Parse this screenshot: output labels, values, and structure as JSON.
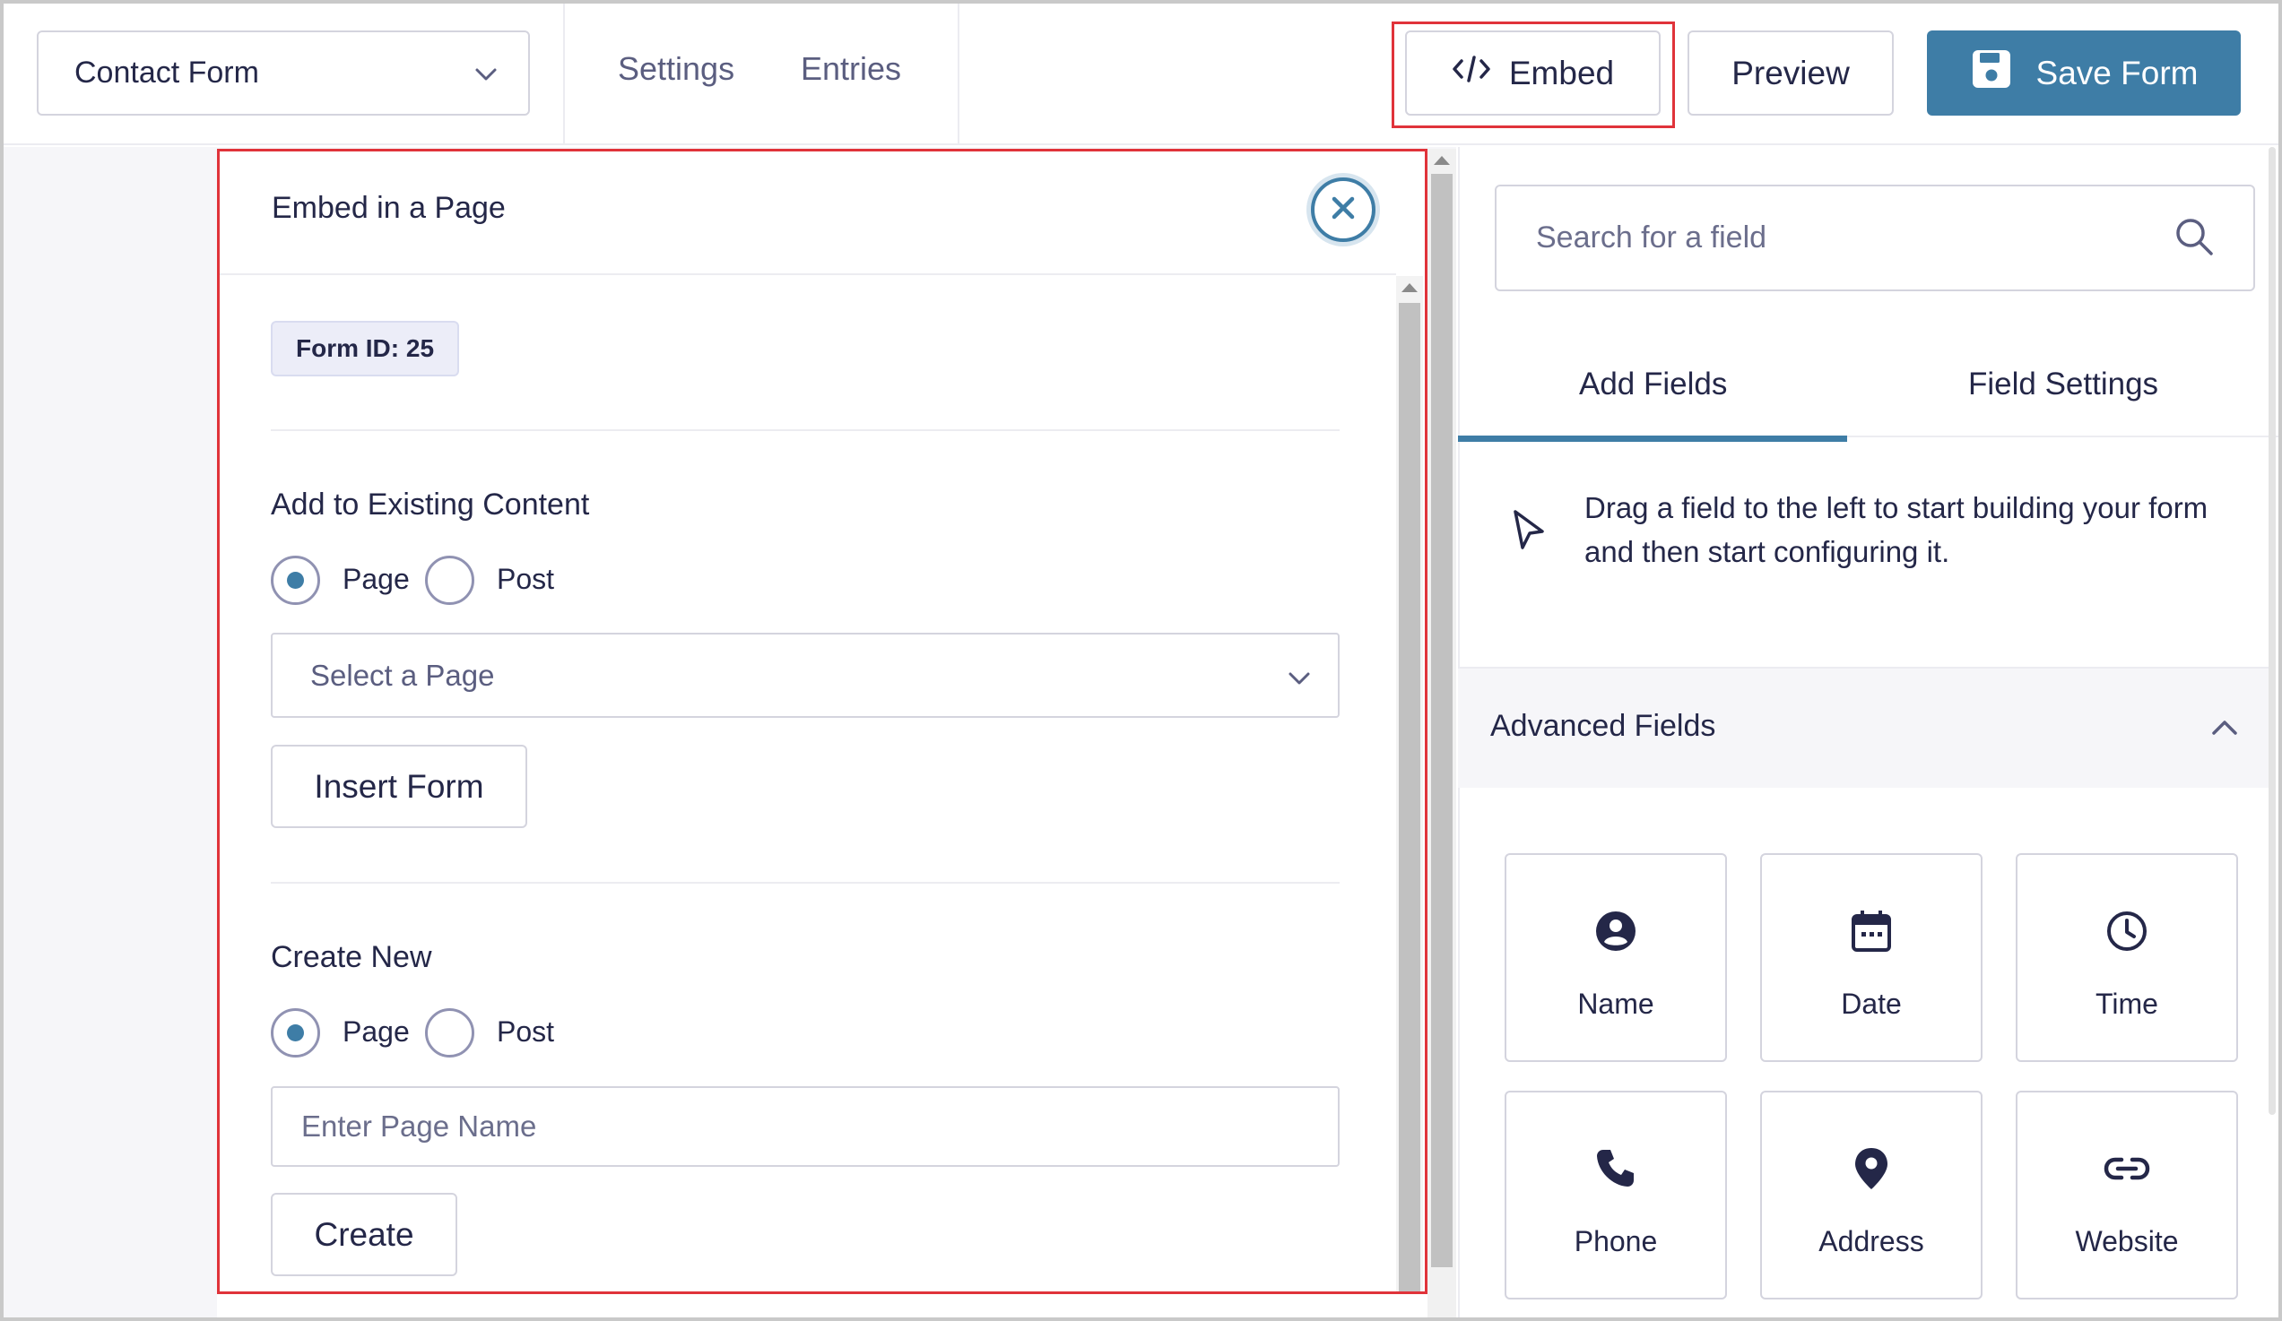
{
  "topbar": {
    "form_selector": "Contact Form",
    "nav": [
      "Settings",
      "Entries"
    ],
    "embed_label": "Embed",
    "preview_label": "Preview",
    "save_label": "Save Form"
  },
  "embed_panel": {
    "title": "Embed in a Page",
    "form_id": "Form ID: 25",
    "existing": {
      "heading": "Add to Existing Content",
      "radio_page": "Page",
      "radio_post": "Post",
      "selected": "Page",
      "select_placeholder": "Select a Page",
      "insert_label": "Insert Form"
    },
    "create_new": {
      "heading": "Create New",
      "radio_page": "Page",
      "radio_post": "Post",
      "selected": "Page",
      "input_placeholder": "Enter Page Name",
      "create_label": "Create"
    }
  },
  "sidebar": {
    "search_placeholder": "Search for a field",
    "tabs": [
      "Add Fields",
      "Field Settings"
    ],
    "active_tab": "Add Fields",
    "hint": "Drag a field to the left to start building your form and then start configuring it.",
    "advanced": {
      "title": "Advanced Fields",
      "fields": [
        {
          "label": "Name",
          "icon": "user-circle-icon"
        },
        {
          "label": "Date",
          "icon": "calendar-icon"
        },
        {
          "label": "Time",
          "icon": "clock-icon"
        },
        {
          "label": "Phone",
          "icon": "phone-icon"
        },
        {
          "label": "Address",
          "icon": "map-pin-icon"
        },
        {
          "label": "Website",
          "icon": "link-icon"
        }
      ]
    }
  },
  "colors": {
    "accent": "#3e7da6",
    "highlight": "#e0333a",
    "text": "#242748"
  }
}
